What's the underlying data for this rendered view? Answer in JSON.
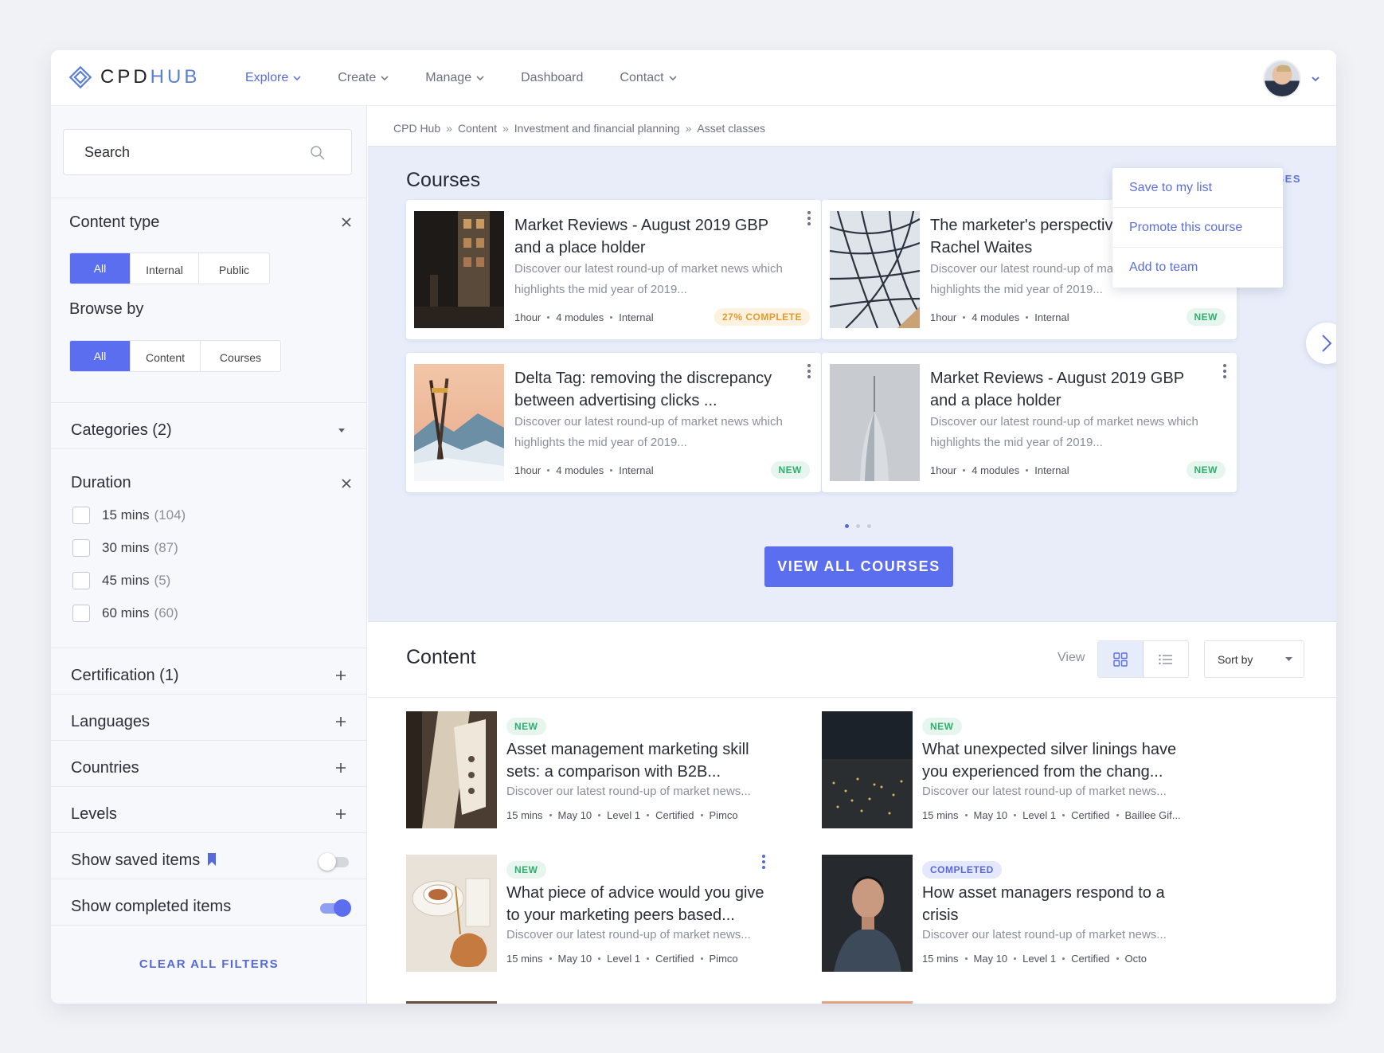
{
  "brand": {
    "name_a": "CPD",
    "name_b": "HUB",
    "accent": "#5b6ef0"
  },
  "nav": [
    {
      "label": "Explore",
      "active": true,
      "dropdown": true
    },
    {
      "label": "Create",
      "dropdown": true
    },
    {
      "label": "Manage",
      "dropdown": true
    },
    {
      "label": "Dashboard",
      "dropdown": false
    },
    {
      "label": "Contact",
      "dropdown": true
    }
  ],
  "sidebar": {
    "search_placeholder": "Search",
    "content_type": {
      "title": "Content type",
      "options": [
        "All",
        "Internal",
        "Public"
      ],
      "selected": "All"
    },
    "browse_by": {
      "title": "Browse by",
      "options": [
        "All",
        "Content",
        "Courses"
      ],
      "selected": "All"
    },
    "categories": {
      "title": "Categories (2)"
    },
    "duration": {
      "title": "Duration",
      "options": [
        {
          "label": "15 mins",
          "count": "(104)"
        },
        {
          "label": "30 mins",
          "count": "(87)"
        },
        {
          "label": "45 mins",
          "count": "(5)"
        },
        {
          "label": "60 mins",
          "count": "(60)"
        }
      ]
    },
    "certification": "Certification (1)",
    "languages": "Languages",
    "countries": "Countries",
    "levels": "Levels",
    "show_saved": {
      "label": "Show saved items",
      "on": false
    },
    "show_completed": {
      "label": "Show completed items",
      "on": true
    },
    "clear_filters": "CLEAR ALL FILTERS"
  },
  "breadcrumb": [
    "CPD Hub",
    "Content",
    "Investment and financial planning",
    "Asset classes"
  ],
  "courses": {
    "title": "Courses",
    "hide_label": "HIDE COURSES",
    "cards": [
      {
        "title": "Market Reviews - August 2019 GBP and a place holder",
        "desc": "Discover our latest round-up of market news which highlights the mid year of 2019...",
        "duration": "1hour",
        "modules": "4 modules",
        "type": "Internal",
        "badge": "27% COMPLETE",
        "badge_kind": "progress"
      },
      {
        "title": "The marketer's perspective: talking to Rachel Waites",
        "desc": "Discover our latest round-up of market news which highlights the mid year of 2019...",
        "duration": "1hour",
        "modules": "4 modules",
        "type": "Internal",
        "badge": "NEW",
        "badge_kind": "new"
      },
      {
        "title": "Delta Tag: removing the discrepancy between advertising clicks ...",
        "desc": "Discover our latest round-up of market news which highlights the mid year of 2019...",
        "duration": "1hour",
        "modules": "4 modules",
        "type": "Internal",
        "badge": "NEW",
        "badge_kind": "new"
      },
      {
        "title": "Market Reviews - August 2019 GBP and a place holder",
        "desc": "Discover our latest round-up of market news which highlights the mid year of 2019...",
        "duration": "1hour",
        "modules": "4 modules",
        "type": "Internal",
        "badge": "NEW",
        "badge_kind": "new"
      }
    ],
    "menu": [
      "Save to my list",
      "Promote this course",
      "Add to team"
    ],
    "view_all": "VIEW ALL COURSES"
  },
  "content": {
    "title": "Content",
    "view_label": "View",
    "sort_label": "Sort by",
    "items": [
      {
        "badge": "NEW",
        "badge_kind": "new",
        "title": "Asset management marketing skill sets: a comparison with B2B...",
        "desc": "Discover our latest round-up of market news...",
        "meta": [
          "15 mins",
          "May 10",
          "Level 1",
          "Certified",
          "Pimco"
        ]
      },
      {
        "badge": "NEW",
        "badge_kind": "new",
        "title": "What unexpected silver linings have you experienced from the chang...",
        "desc": "Discover our latest round-up of market news...",
        "meta": [
          "15 mins",
          "May 10",
          "Level 1",
          "Certified",
          "Baillee Gif..."
        ]
      },
      {
        "badge": "NEW",
        "badge_kind": "new",
        "title": "What piece of advice would you give to your marketing peers based...",
        "desc": "Discover our latest round-up of market news...",
        "meta": [
          "15 mins",
          "May 10",
          "Level 1",
          "Certified",
          "Pimco"
        ]
      },
      {
        "badge": "COMPLETED",
        "badge_kind": "completed",
        "title": "How asset managers respond to a crisis",
        "desc": "Discover our latest round-up of market news...",
        "meta": [
          "15 mins",
          "May 10",
          "Level 1",
          "Certified",
          "Octo"
        ]
      }
    ]
  }
}
